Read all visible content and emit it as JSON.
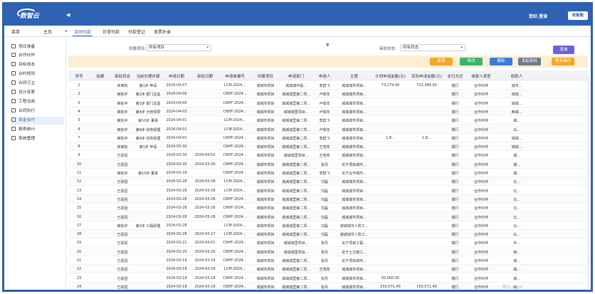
{
  "header": {
    "logo_text": "数智云",
    "collapse_icon": "◀",
    "greeting": "您好,登录",
    "user_button": "老板账"
  },
  "nav": {
    "menu_label": "菜单",
    "home_label": "主页",
    "tabs": [
      {
        "label": "合同付款",
        "active": true
      },
      {
        "label": "日常付款",
        "active": false
      },
      {
        "label": "付款登记",
        "active": false
      },
      {
        "label": "发票补录",
        "active": false
      }
    ]
  },
  "sidebar": {
    "items": [
      {
        "label": "项目准备",
        "active": false
      },
      {
        "label": "合作伙伴",
        "active": false
      },
      {
        "label": "目标成本",
        "active": false
      },
      {
        "label": "合约规划",
        "active": false
      },
      {
        "label": "合同订立",
        "active": false
      },
      {
        "label": "设计变更",
        "active": false
      },
      {
        "label": "工程洽商",
        "active": false
      },
      {
        "label": "合同执行",
        "active": false
      },
      {
        "label": "资金支付",
        "active": true
      },
      {
        "label": "报表统计",
        "active": false
      },
      {
        "label": "系统管理",
        "active": false
      }
    ]
  },
  "filters": {
    "project_label": "所属项目:",
    "project_value": "所有项目",
    "status_label": "审批状态:",
    "status_value": "所有状态",
    "query_button": "查询"
  },
  "toolbar": {
    "buttons": [
      {
        "label": "新增",
        "color": "#f5a623"
      },
      {
        "label": "修改",
        "color": "#3cb371"
      },
      {
        "label": "删除",
        "color": "#3b7ddd"
      },
      {
        "label": "发起审批",
        "color": "#6c7a89"
      },
      {
        "label": "更多操作",
        "color": "#f5a623"
      }
    ]
  },
  "table": {
    "columns": [
      "序号",
      "结果",
      "审批状态",
      "当前办理步骤",
      "申请日期",
      "审批日期",
      "申请单编号",
      "所属项目",
      "申请部门",
      "申请人",
      "主题",
      "计划申请金额(元)",
      "实际申请金额(元)",
      "支付方式",
      "收款人类型",
      "收款人"
    ],
    "rows": [
      [
        "1",
        "",
        "未审批",
        "第1步 申请",
        "2024-04-07",
        "",
        "LCM-2024...",
        "城城市项目",
        "城城城市组...",
        "李碧飞",
        "城城城市项目...",
        "73,274.00",
        "723,384.00",
        "银行",
        "合作伙伴",
        "城市..."
      ],
      [
        "2",
        "",
        "审批中",
        "第2步 部门总监",
        "2024-04-06",
        "",
        "CNHF-2024...",
        "城城市项目",
        "城城城里第二项...",
        "卢俊年",
        "城城城市项目...",
        "",
        "",
        "银行",
        "合作伙伴",
        "城城..."
      ],
      [
        "3",
        "",
        "审批中",
        "第3步 部门总监",
        "2024-04-06",
        "",
        "CNHF-2024...",
        "城城市项目",
        "城城城里第二项...",
        "卢俊年",
        "城城城市项目...",
        "",
        "",
        "银行",
        "合作伙伴",
        "城城..."
      ],
      [
        "4",
        "",
        "审批中",
        "第4步 分管领导",
        "2024-04-03",
        "",
        "CNHF-2024...",
        "城城市项目",
        "城城城里项目...",
        "卢俊年",
        "城城城市项目...",
        "",
        "",
        "银行",
        "合作伙伴",
        "西城..."
      ],
      [
        "5",
        "",
        "审批中",
        "第10步 董事",
        "2024-04-01",
        "",
        "LCM-2024...",
        "城城市项目",
        "城城城里第二项...",
        "李碧飞",
        "城城城市项目...",
        "",
        "",
        "银行",
        "合作伙伴",
        "城..."
      ],
      [
        "6",
        "",
        "审批中",
        "第9步 财务经理",
        "2024-04-01",
        "",
        "LCM-2024...",
        "城城市项目",
        "城城城里第二项...",
        "卢俊年",
        "城城城市项目...",
        "",
        "",
        "银行",
        "合作伙伴",
        "北..."
      ],
      [
        "7",
        "",
        "审批中",
        "第9步 财务经理",
        "2024-04-01",
        "",
        "CNHF-2024...",
        "城城市项目",
        "城城城里第二项...",
        "李碧飞",
        "城城城市项目...",
        "1,8...",
        "1,8...",
        "银行",
        "合作伙伴",
        "城城..."
      ],
      [
        "8",
        "",
        "未审批",
        "第1步 申请",
        "2024-03-30",
        "",
        "CNHF-2024...",
        "城城市项目",
        "城城城里第二项...",
        "王亮亮",
        "城城城市项目...",
        "",
        "",
        "银行",
        "合作伙伴",
        "城城..."
      ],
      [
        "9",
        "",
        "已驳回",
        "",
        "2024-03-30",
        "2024-04-02",
        "CNHF-2024...",
        "城城市项目",
        "城城城里项目...",
        "王亮亮",
        "城城城市项目...",
        "",
        "",
        "银行",
        "合作伙伴",
        "城..."
      ],
      [
        "10",
        "",
        "已驳回",
        "",
        "2024-03-30",
        "2024-03-30",
        "CNHF-2024...",
        "城城市项目",
        "城城城里第二项...",
        "张丹",
        "关于项目城市...",
        "",
        "",
        "银行",
        "合作伙伴",
        "城..."
      ],
      [
        "11",
        "",
        "审批中",
        "第10步 董事",
        "2024-03-29",
        "",
        "CNHF-2024...",
        "城城市项目",
        "城城城里第二项...",
        "李碧飞",
        "关于合作城市...",
        "",
        "",
        "银行",
        "合作伙伴",
        "城..."
      ],
      [
        "12",
        "",
        "已驳回",
        "",
        "2024-03-28",
        "2024-03-28",
        "LCM-2024...",
        "城城市项目",
        "城城城里第二项...",
        "刘磊",
        "城城城市项目...",
        "",
        "",
        "银行",
        "合作伙伴",
        "北..."
      ],
      [
        "13",
        "",
        "已驳回",
        "",
        "2024-03-28",
        "2024-03-28",
        "LCM-2024...",
        "城城市项目",
        "城城城里第二项...",
        "刘磊",
        "城城城市项目...",
        "",
        "",
        "银行",
        "合作伙伴",
        "北..."
      ],
      [
        "14",
        "",
        "已驳回",
        "",
        "2024-03-28",
        "2024-03-28",
        "CNHF-2024...",
        "城城市项目",
        "城城城里第二项...",
        "刘磊",
        "城城城市项目...",
        "",
        "",
        "银行",
        "合作伙伴",
        "北..."
      ],
      [
        "15",
        "",
        "已驳回",
        "",
        "2024-03-28",
        "2024-03-28",
        "CNHF-2024...",
        "城城市项目",
        "城城城里第二项...",
        "刘磊",
        "城城城市项目...",
        "",
        "",
        "银行",
        "合作伙伴",
        "北..."
      ],
      [
        "16",
        "",
        "已驳回",
        "",
        "2024-03-28",
        "2024-03-28",
        "CNHF-2024...",
        "城城市项目",
        "城城城里第二项...",
        "刘磊",
        "城城城市项目...",
        "",
        "",
        "银行",
        "合作伙伴",
        "北..."
      ],
      [
        "17",
        "",
        "审批中",
        "第3步 工程经理",
        "2024-03-28",
        "",
        "LCM-2024...",
        "城城市项目",
        "城城城里第二项...",
        "刘磊",
        "城城城市人防工...",
        "",
        "",
        "银行",
        "合作伙伴",
        "北..."
      ],
      [
        "18",
        "",
        "已驳回",
        "",
        "2024-03-28",
        "2024-03-27",
        "LCM-2024...",
        "城城市项目",
        "城城城里第二项...",
        "刘磊",
        "城城城市人防工...",
        "",
        "",
        "银行",
        "合作伙伴",
        "北..."
      ],
      [
        "19",
        "",
        "已驳回",
        "",
        "2024-03-21",
        "2024-04-01",
        "CNHF-2024...",
        "城城市项目",
        "城城城里项目...",
        "张丹",
        "关于项目工程...",
        "",
        "",
        "银行",
        "合作伙伴",
        "中..."
      ],
      [
        "20",
        "",
        "已驳回",
        "",
        "2024-03-20",
        "2024-03-20",
        "CNHF-2024...",
        "城城市项目",
        "城城城里项目...",
        "张丹",
        "关于土方施工...",
        "",
        "",
        "银行",
        "合作伙伴",
        "西..."
      ],
      [
        "21",
        "",
        "已驳回",
        "",
        "2024-03-19",
        "2024-03-19",
        "CNHF-2024...",
        "城城市项目",
        "城城城里第二项...",
        "张丹",
        "关于项目城市...",
        "",
        "",
        "银行",
        "合作伙伴",
        "城..."
      ],
      [
        "22",
        "",
        "已驳回",
        "",
        "2024-03-18",
        "2024-03-18",
        "LCM-2024...",
        "城城市项目",
        "城城城里第二项...",
        "王亮亮",
        "城城城市项目...",
        "",
        "",
        "银行",
        "合作伙伴",
        "城..."
      ],
      [
        "23",
        "",
        "已驳回",
        "",
        "2024-03-18",
        "2024-03-18",
        "CNHF-2024...",
        "城城市项目",
        "城城城里第二项...",
        "张丹",
        "城城城市项目...",
        "50,000.00",
        "",
        "银行",
        "合作伙伴",
        "城..."
      ],
      [
        "24",
        "",
        "已驳回",
        "",
        "2024-03-18",
        "2024-03-18",
        "CNHF-2024...",
        "城城市项目",
        "城城城里第二项...",
        "张丹",
        "城城城市项目...",
        "150,571.40",
        "150,571.40",
        "银行",
        "合作伙伴",
        "城..."
      ]
    ]
  },
  "watermark": "数云 Logo"
}
